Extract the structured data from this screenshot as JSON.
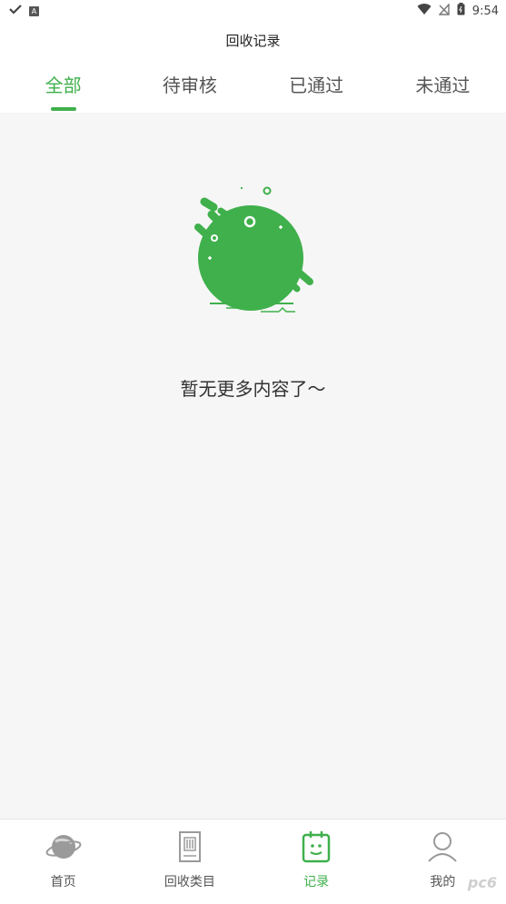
{
  "status_bar": {
    "time": "9:54",
    "left_icons": [
      "check-icon",
      "app-a-icon"
    ],
    "right_icons": [
      "wifi-icon",
      "signal-off-icon",
      "battery-icon"
    ]
  },
  "header": {
    "title": "回收记录"
  },
  "tabs": [
    {
      "label": "全部",
      "active": true
    },
    {
      "label": "待审核",
      "active": false
    },
    {
      "label": "已通过",
      "active": false
    },
    {
      "label": "未通过",
      "active": false
    }
  ],
  "empty_state": {
    "icon": "empty-blob-illustration",
    "message": "暂无更多内容了～"
  },
  "bottom_nav": [
    {
      "label": "首页",
      "icon": "planet-icon",
      "active": false
    },
    {
      "label": "回收类目",
      "icon": "category-icon",
      "active": false
    },
    {
      "label": "记录",
      "icon": "record-icon",
      "active": true
    },
    {
      "label": "我的",
      "icon": "user-icon",
      "active": false
    }
  ],
  "colors": {
    "accent": "#3fb04b",
    "background": "#f6f6f6",
    "text": "#333333"
  },
  "watermark": "pc6"
}
